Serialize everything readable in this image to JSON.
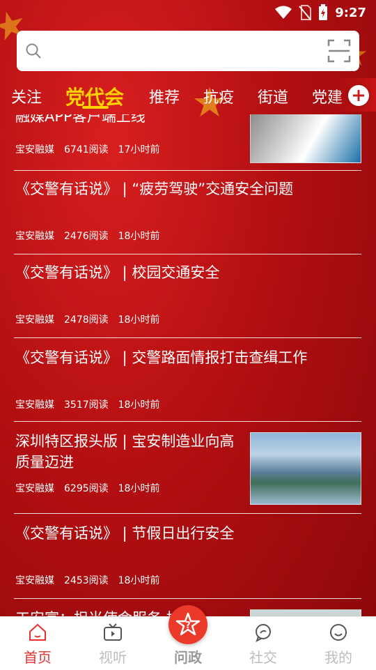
{
  "status_bar": {
    "time": "9:27"
  },
  "search": {
    "placeholder": ""
  },
  "tabs": [
    {
      "label": "关注",
      "active": false
    },
    {
      "label": "党代会",
      "active": true
    },
    {
      "label": "推荐",
      "active": false
    },
    {
      "label": "抗疫",
      "active": false
    },
    {
      "label": "街道",
      "active": false
    },
    {
      "label": "党建",
      "active": false
    }
  ],
  "feed": [
    {
      "title": "融媒APP客户端上线",
      "source": "宝安融媒",
      "reads": "6741阅读",
      "time": "17小时前",
      "has_thumb": true
    },
    {
      "title": "《交警有话说》 | “疲劳驾驶”交通安全问题",
      "source": "宝安融媒",
      "reads": "2476阅读",
      "time": "18小时前",
      "has_thumb": false
    },
    {
      "title": "《交警有话说》 | 校园交通安全",
      "source": "宝安融媒",
      "reads": "2478阅读",
      "time": "18小时前",
      "has_thumb": false
    },
    {
      "title": "《交警有话说》 | 交警路面情报打击查缉工作",
      "source": "宝安融媒",
      "reads": "3517阅读",
      "time": "18小时前",
      "has_thumb": false
    },
    {
      "title": "深圳特区报头版 | 宝安制造业向高质量迈进",
      "source": "宝安融媒",
      "reads": "6295阅读",
      "time": "18小时前",
      "has_thumb": true
    },
    {
      "title": "《交警有话说》 | 节假日出行安全",
      "source": "宝安融媒",
      "reads": "2453阅读",
      "time": "18小时前",
      "has_thumb": false
    },
    {
      "title": "工安富：担当使命服务       拾摭",
      "source": "",
      "reads": "",
      "time": "",
      "has_thumb": true
    }
  ],
  "tabbar": [
    {
      "label": "首页",
      "icon": "home-icon",
      "active": true
    },
    {
      "label": "视听",
      "icon": "tv-icon",
      "active": false
    },
    {
      "label": "问政",
      "icon": "question-star-icon",
      "active": false
    },
    {
      "label": "社交",
      "icon": "chat-bubble-icon",
      "active": false
    },
    {
      "label": "我的",
      "icon": "smile-face-icon",
      "active": false
    }
  ],
  "colors": {
    "accent_red": "#e53030",
    "tab_active": "#ffd200",
    "background_red": "#b30f12"
  }
}
